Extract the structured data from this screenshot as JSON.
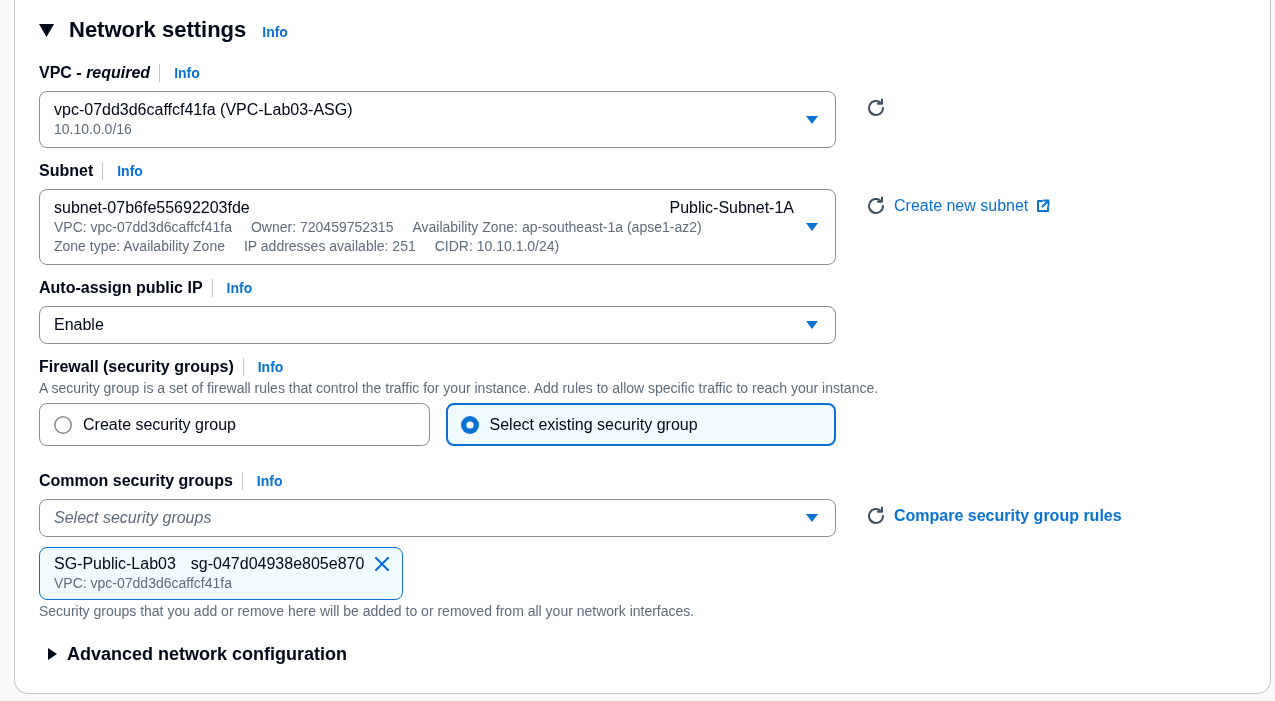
{
  "section": {
    "title": "Network settings",
    "info": "Info",
    "expanded": true
  },
  "fields": [
    {
      "kind": "select",
      "label": "VPC - *required*",
      "info": "Info",
      "value": "vpc-07dd3d6caffcf41fa (VPC-Lab03-ASG)",
      "details": [
        [
          "10.10.0.0/16"
        ]
      ],
      "actions": [
        {
          "kind": "refresh"
        }
      ]
    },
    {
      "kind": "select",
      "label": "Subnet",
      "info": "Info",
      "value": "subnet-07b6fe55692203fde",
      "tag": "Public-Subnet-1A",
      "details": [
        [
          "VPC: vpc-07dd3d6caffcf41fa",
          "Owner: 720459752315",
          "Availability Zone: ap-southeast-1a (apse1-az2)"
        ],
        [
          "Zone type: Availability Zone",
          "IP addresses available: 251",
          "CIDR: 10.10.1.0/24)"
        ]
      ],
      "actions": [
        {
          "kind": "refresh"
        },
        {
          "kind": "link",
          "label": "Create new subnet",
          "external": true
        }
      ]
    },
    {
      "kind": "select",
      "label": "Auto-assign public IP",
      "info": "Info",
      "value": "Enable"
    },
    {
      "kind": "radiogroup",
      "label": "Firewall (security groups)",
      "info": "Info",
      "description": "A security group is a set of firewall rules that control the traffic for your instance. Add rules to allow specific traffic to reach your instance.",
      "options": [
        {
          "label": "Create security group",
          "selected": false
        },
        {
          "label": "Select existing security group",
          "selected": true
        }
      ]
    },
    {
      "kind": "multiselect",
      "label": "Common security groups",
      "info": "Info",
      "placeholder": "Select security groups",
      "actions": [
        {
          "kind": "refresh"
        },
        {
          "kind": "button",
          "label": "Compare security group rules"
        }
      ],
      "tokens": [
        {
          "name": "SG-Public-Lab03",
          "group_id": "sg-047d04938e805e870",
          "details": "VPC: vpc-07dd3d6caffcf41fa"
        }
      ],
      "constraint": "Security groups that you add or remove here will be added to or removed from all your network interfaces."
    }
  ],
  "advanced": {
    "title": "Advanced network configuration",
    "expanded": false
  }
}
